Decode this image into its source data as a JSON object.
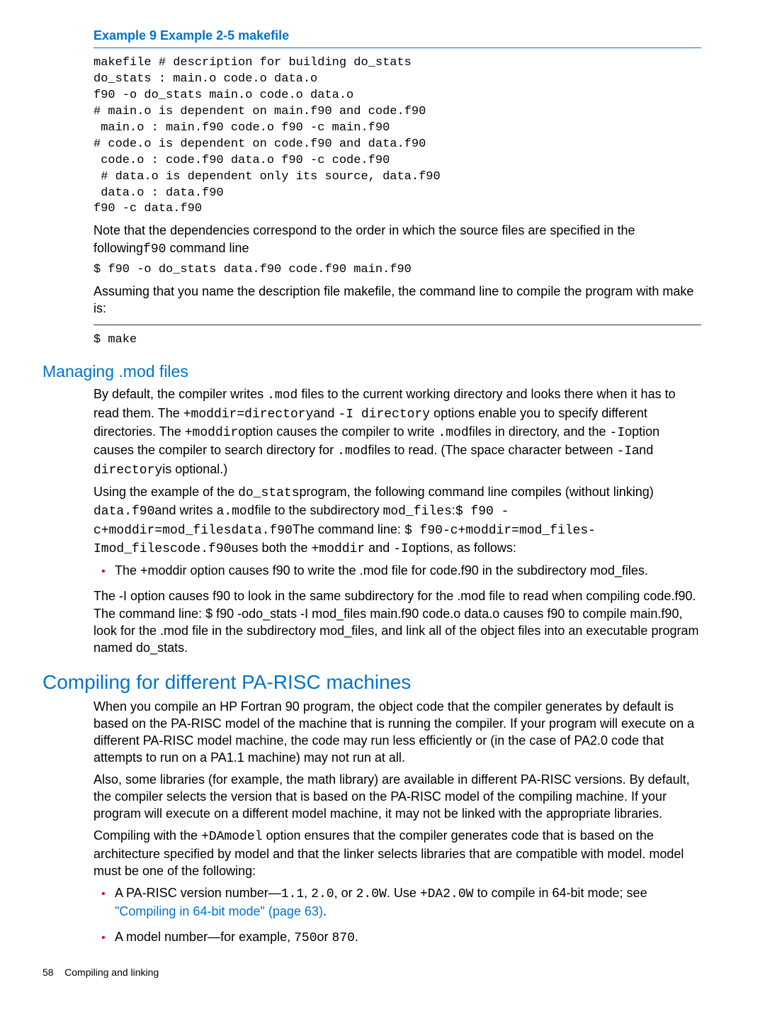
{
  "example": {
    "title": "Example 9 Example 2-5 makefile",
    "code": "makefile # description for building do_stats\ndo_stats : main.o code.o data.o\nf90 -o do_stats main.o code.o data.o\n# main.o is dependent on main.f90 and code.f90\n main.o : main.f90 code.o f90 -c main.f90\n# code.o is dependent on code.f90 and data.f90\n code.o : code.f90 data.o f90 -c code.f90\n # data.o is dependent only its source, data.f90\n data.o : data.f90\nf90 -c data.f90"
  },
  "p1_a": "Note that the dependencies correspond to the order in which the source files are specified in the following",
  "p1_code": "f90",
  "p1_b": " command line",
  "cmd1": "$ f90 -o do_stats data.f90 code.f90 main.f90",
  "p2": "Assuming that you name the description file makefile, the command line to compile the program with make is:",
  "cmd2": "$ make",
  "mod": {
    "heading": "Managing .mod files",
    "para1": {
      "t1": "By default, the compiler writes ",
      "c1": ".mod",
      "t2": " files to the current working directory and looks there when it has to read them. The ",
      "c2": "+moddir=directory",
      "t3": "and ",
      "c3": "-I directory",
      "t4": " options enable you to specify different directories. The ",
      "c4": "+moddir",
      "t5": "option causes the compiler to write ",
      "c5": ".mod",
      "t6": "files in directory, and the ",
      "c6": "-I",
      "t7": "option causes the compiler to search directory for ",
      "c7": ".mod",
      "t8": "files to read. (The space character between ",
      "c8": "-I",
      "t9": "and ",
      "c9": "directory",
      "t10": "is optional.)"
    },
    "para2": {
      "t1": "Using the example of the ",
      "c1": "do_stats",
      "t2": "program, the following command line compiles (without linking) ",
      "c2": "data.f90",
      "t3": "and writes ",
      "c3": "a.mod",
      "t4": "file to the subdirectory ",
      "c4": "mod_files",
      "t5": ":",
      "c5": "$ f90 -c+moddir=mod_files",
      "c6": "data.f90",
      "t6": "The command line: ",
      "c7": "$ f90-c+moddir=mod_files-Imod_files",
      "c8": "code.f90",
      "t7": "uses both the ",
      "c9": "+moddir",
      "t8": " and ",
      "c10": "-I",
      "t9": "options, as follows:"
    },
    "bullet1": "The +moddir option causes f90 to write the .mod file for code.f90 in the subdirectory mod_files.",
    "para3": "The -I option causes f90 to look in the same subdirectory for the .mod file to read when compiling code.f90. The command line: $ f90 -odo_stats -I mod_files main.f90 code.o data.o causes f90 to compile main.f90, look for the .mod file in the subdirectory mod_files, and link all of the object files into an executable program named do_stats."
  },
  "parisc": {
    "heading": "Compiling for different PA-RISC machines",
    "p1": "When you compile an HP Fortran 90 program, the object code that the compiler generates by default is based on the PA-RISC model of the machine that is running the compiler. If your program will execute on a different PA-RISC model machine, the code may run less efficiently or (in the case of PA2.0 code that attempts to run on a PA1.1 machine) may not run at all.",
    "p2": "Also, some libraries (for example, the math library) are available in different PA-RISC versions. By default, the compiler selects the version that is based on the PA-RISC model of the compiling machine. If your program will execute on a different model machine, it may not be linked with the appropriate libraries.",
    "p3": {
      "t1": "Compiling with the ",
      "c1": "+DAmodel",
      "t2": " option ensures that the compiler generates code that is based on the architecture specified by model and that the linker selects libraries that are compatible with model. model must be one of the following:"
    },
    "b1": {
      "t1": "A PA-RISC version number—",
      "c1": "1.1",
      "t2": ", ",
      "c2": "2.0",
      "t3": ", or ",
      "c3": "2.0W",
      "t4": ". Use ",
      "c4": "+DA2.0W",
      "t5": " to compile in 64-bit mode; see ",
      "link": "\"Compiling in 64-bit mode\" (page 63)",
      "t6": "."
    },
    "b2": {
      "t1": "A model number—for example, ",
      "c1": "750",
      "t2": "or ",
      "c2": "870",
      "t3": "."
    }
  },
  "footer": {
    "page": "58",
    "label": "Compiling and linking"
  }
}
